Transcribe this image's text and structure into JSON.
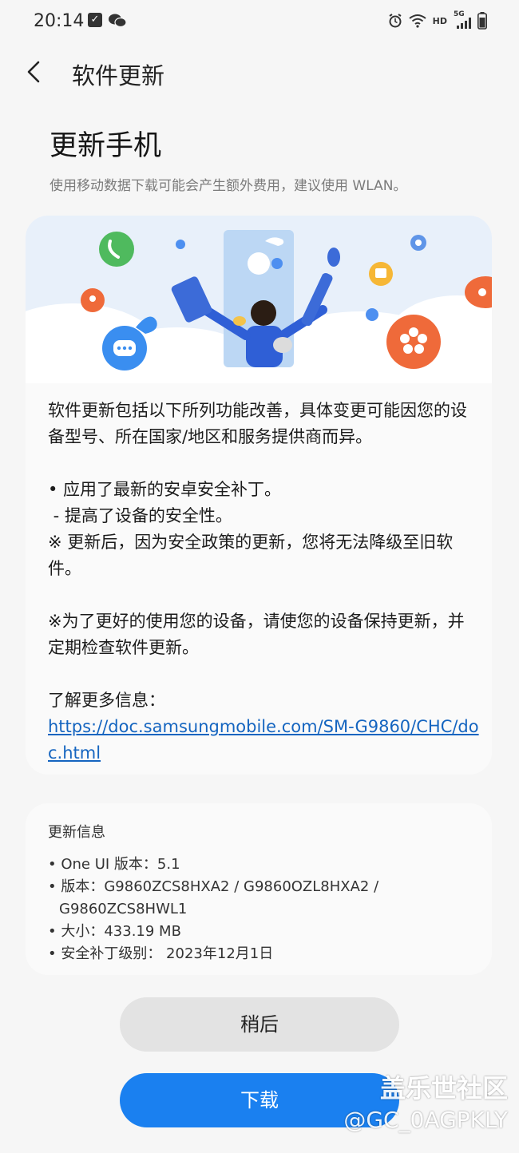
{
  "status_bar": {
    "time": "20:14",
    "hd": "HD",
    "network": "5G"
  },
  "appbar": {
    "title": "软件更新"
  },
  "page": {
    "title": "更新手机",
    "warning": "使用移动数据下载可能会产生额外费用，建议使用 WLAN。"
  },
  "release_notes": {
    "intro": "软件更新包括以下所列功能改善，具体变更可能因您的设备型号、所在国家/地区和服务提供商而异。",
    "bullet1": "• 应用了最新的安卓安全补丁。",
    "bullet1_sub": " - 提高了设备的安全性。",
    "note1": "※ 更新后，因为安全政策的更新，您将无法降级至旧软件。",
    "note2": "※为了更好的使用您的设备，请使您的设备保持更新，并定期检查软件更新。",
    "more_label": "了解更多信息：",
    "more_link": "https://doc.samsungmobile.com/SM-G9860/CHC/doc.html"
  },
  "update_info": {
    "title": "更新信息",
    "oneui": "• One UI 版本：5.1",
    "version": "• 版本：G9860ZCS8HXA2 / G9860OZL8HXA2 /",
    "version_cont": "G9860ZCS8HWL1",
    "size": "• 大小：433.19 MB",
    "patch": "• 安全补丁级别： 2023年12月1日"
  },
  "buttons": {
    "later": "稍后",
    "download": "下载"
  },
  "watermark": {
    "line1": "盖乐世社区",
    "line2": "@GC_0AGPKLY"
  },
  "colors": {
    "accent": "#1a80f0",
    "link": "#1565c0",
    "background": "#f6f6f6"
  }
}
